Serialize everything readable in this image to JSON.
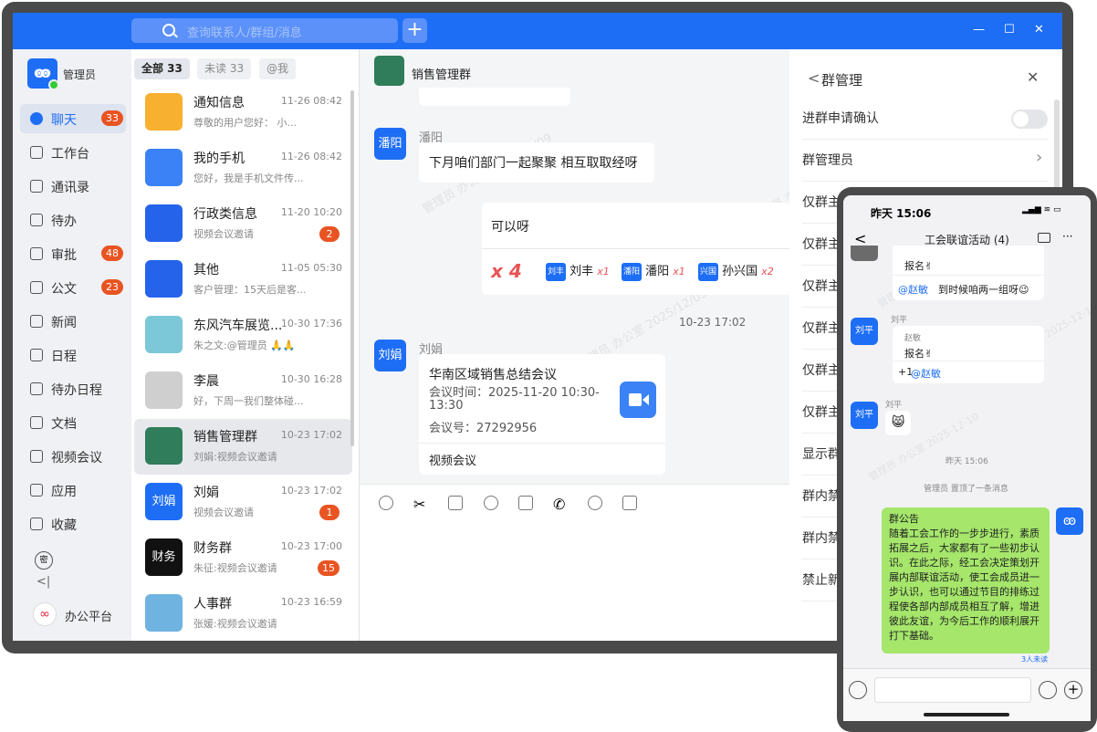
{
  "search": {
    "placeholder": "查询联系人/群组/消息"
  },
  "titlebar": {
    "plus": "+",
    "minimize": "—",
    "maximize": "☐",
    "close": "✕"
  },
  "user": {
    "name": "管理员"
  },
  "nav": [
    {
      "label": "聊天",
      "badge": "33"
    },
    {
      "label": "工作台",
      "badge": ""
    },
    {
      "label": "通讯录",
      "badge": ""
    },
    {
      "label": "待办",
      "badge": ""
    },
    {
      "label": "审批",
      "badge": "48"
    },
    {
      "label": "公文",
      "badge": "23"
    },
    {
      "label": "新闻",
      "badge": ""
    },
    {
      "label": "日程",
      "badge": ""
    },
    {
      "label": "待办日程",
      "badge": ""
    },
    {
      "label": "文档",
      "badge": ""
    },
    {
      "label": "视频会议",
      "badge": ""
    },
    {
      "label": "应用",
      "badge": ""
    },
    {
      "label": "收藏",
      "badge": ""
    }
  ],
  "nav_bottom": {
    "secret_icon": "密",
    "collapse": "<|",
    "platform": "办公平台"
  },
  "tabs": [
    "全部 33",
    "未读 33",
    "@我"
  ],
  "chats": [
    {
      "name": "通知信息",
      "time": "11-26 08:42",
      "preview": "尊敬的用户您好： 小...",
      "badge": "",
      "avatar": "",
      "color": "#f7b02f"
    },
    {
      "name": "我的手机",
      "time": "11-26 08:42",
      "preview": "您好，我是手机文件传...",
      "badge": "",
      "avatar": "",
      "color": "#3b82f6"
    },
    {
      "name": "行政类信息",
      "time": "11-20 10:20",
      "preview": "视频会议邀请",
      "badge": "2",
      "avatar": "",
      "color": "#2563eb"
    },
    {
      "name": "其他",
      "time": "11-05 05:30",
      "preview": "客户管理：15天后是客...",
      "badge": "",
      "avatar": "",
      "color": "#2563eb"
    },
    {
      "name": "东风汽车展览...",
      "time": "10-30 17:36",
      "preview": "朱之文:@管理员 🙏🙏",
      "badge": "",
      "avatar": "",
      "color": "#7cc7d8"
    },
    {
      "name": "李晨",
      "time": "10-30 16:28",
      "preview": "好，下周一我们整体碰...",
      "badge": "",
      "avatar": "",
      "color": "#cfcfcf"
    },
    {
      "name": "销售管理群",
      "time": "10-23 17:02",
      "preview": "刘娟:视频会议邀请",
      "badge": "",
      "avatar": "",
      "color": "#2f7d5b"
    },
    {
      "name": "刘娟",
      "time": "10-23 17:02",
      "preview": "视频会议邀请",
      "badge": "1",
      "avatar": "刘娟",
      "color": "#1e6ef5"
    },
    {
      "name": "财务群",
      "time": "10-23 17:00",
      "preview": "朱征:视频会议邀请",
      "badge": "15",
      "avatar": "财务",
      "color": "#111111"
    },
    {
      "name": "人事群",
      "time": "10-23 16:59",
      "preview": "张媛:视频会议邀请",
      "badge": "",
      "avatar": "",
      "color": "#6fb3e0"
    }
  ],
  "chat": {
    "title": "销售管理群",
    "msg1": {
      "avatar": "潘阳",
      "sender": "潘阳",
      "text": "下月咱们部门一起聚聚 相互取取经呀"
    },
    "msg2": {
      "text": "可以呀",
      "count": "x 4",
      "reactions": [
        {
          "avatar": "刘丰",
          "name": "刘丰",
          "count": "x1"
        },
        {
          "avatar": "潘阳",
          "name": "潘阳",
          "count": "x1"
        },
        {
          "avatar": "兴国",
          "name": "孙兴国",
          "count": "x2"
        }
      ]
    },
    "time": "10-23 17:02",
    "msg3": {
      "avatar": "刘娟",
      "sender": "刘娟",
      "title": "华南区域销售总结会议",
      "time_line1": "会议时间：2025-11-20 10:30-",
      "time_line2": "13:30",
      "number": "会议号：27292956",
      "footer": "视频会议"
    },
    "watermark": "管理员 办公室 2025/12/09"
  },
  "panel": {
    "back": "<",
    "title": "群管理",
    "close": "✕",
    "rows": [
      "进群申请确认",
      "群管理员",
      "仅群主",
      "仅群主",
      "仅群主",
      "仅群主",
      "仅群主",
      "仅群主",
      "显示群",
      "群内禁",
      "群内禁",
      "禁止新"
    ],
    "arrow": "›"
  },
  "phone": {
    "time": "昨天 15:06",
    "status": "▂▄▆ ≋ ▭",
    "title": "工会联谊活动 (4)",
    "back": "<",
    "more": "···",
    "msg0": {
      "line1": "报名✌",
      "line2": "@赵敏",
      "line3": "到时候咱两一组呀😉"
    },
    "msg1": {
      "sender": "刘平",
      "avatar": "刘平",
      "quote": "赵敏",
      "line": "报名✌",
      "plus": "+1",
      "mention": "@赵敏"
    },
    "msg2": {
      "sender": "刘平",
      "avatar": "刘平",
      "emoji": "😸"
    },
    "system": "管理员 置顶了一条消息",
    "notice": {
      "title": "群公告",
      "body": "随着工会工作的一步步进行，素质拓展之后，大家都有了一些初步认识。在此之际，经工会决定策划开展内部联谊活动，使工会成员进一步认识，也可以通过节目的排练过程使各部内部成员相互了解，增进彼此友谊，为今后工作的顺利展开打下基础。",
      "unread": "3人未读"
    },
    "watermark": "管理员 办公室 2025-12-10"
  }
}
